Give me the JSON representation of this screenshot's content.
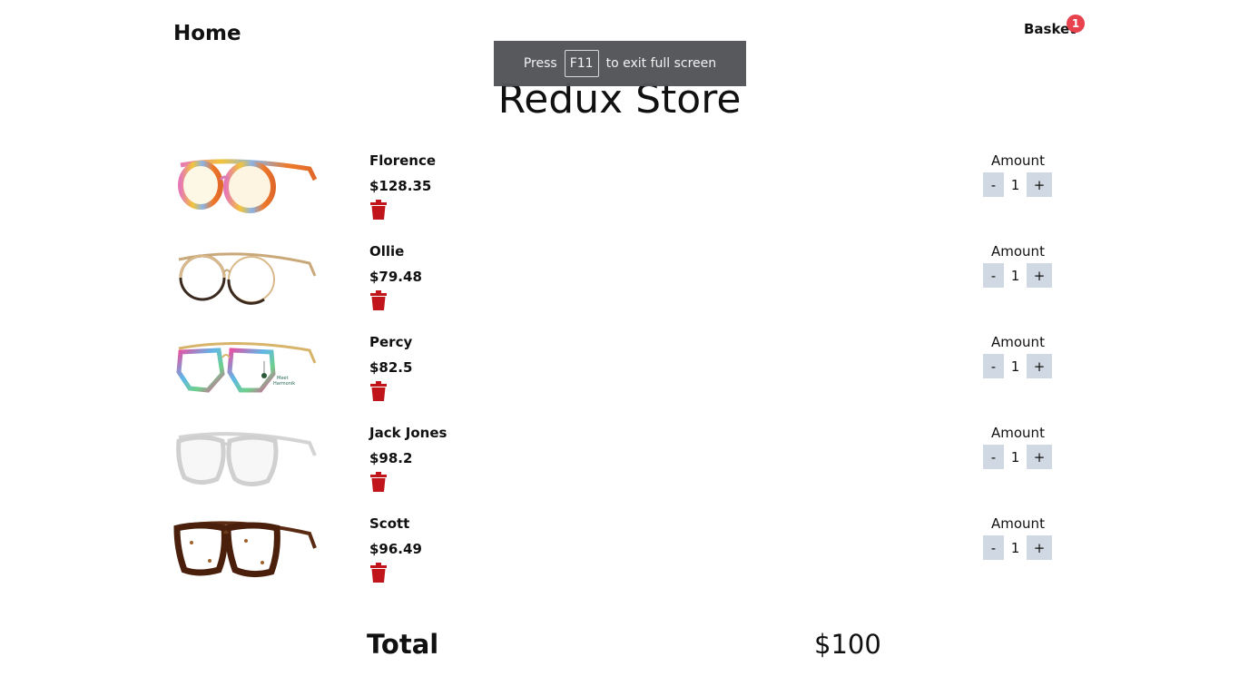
{
  "nav": {
    "home_label": "Home",
    "basket_label": "Basket",
    "basket_count": "1"
  },
  "fullscreen_notice": {
    "prefix": "Press",
    "key": "F11",
    "suffix": "to exit full screen"
  },
  "title": "Redux Store",
  "products": [
    {
      "name": "Florence",
      "price": "$128.35",
      "amount_label": "Amount",
      "quantity": "1",
      "minus": "-",
      "plus": "+",
      "frame_color": "rainbow"
    },
    {
      "name": "Ollie",
      "price": "$79.48",
      "amount_label": "Amount",
      "quantity": "1",
      "minus": "-",
      "plus": "+",
      "frame_color": "gold-black"
    },
    {
      "name": "Percy",
      "price": "$82.5",
      "amount_label": "Amount",
      "quantity": "1",
      "minus": "-",
      "plus": "+",
      "frame_color": "multicolor-gold"
    },
    {
      "name": "Jack Jones",
      "price": "$98.2",
      "amount_label": "Amount",
      "quantity": "1",
      "minus": "-",
      "plus": "+",
      "frame_color": "clear"
    },
    {
      "name": "Scott",
      "price": "$96.49",
      "amount_label": "Amount",
      "quantity": "1",
      "minus": "-",
      "plus": "+",
      "frame_color": "tortoise"
    }
  ],
  "total": {
    "label": "Total",
    "value": "$100"
  },
  "colors": {
    "badge": "#e8424f",
    "trash": "#c0151b",
    "qty_button": "#cfd8e3",
    "overlay": "#525458"
  }
}
